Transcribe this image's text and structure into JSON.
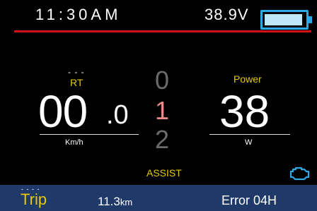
{
  "status": {
    "time": "11:30AM",
    "voltage": "38.9V",
    "battery_level_percent": 95
  },
  "speed": {
    "mode_dashes": "- - -",
    "label": "RT",
    "value_int": "00",
    "value_dec": ".0",
    "unit": "Km/h"
  },
  "assist": {
    "levels": [
      "0",
      "1",
      "2"
    ],
    "active_level": "1",
    "label": "ASSIST"
  },
  "power": {
    "label": "Power",
    "value": "38",
    "unit": "W"
  },
  "bottom": {
    "mode_dashes": "- - - -",
    "trip_label": "Trip",
    "distance_value": "11.3",
    "distance_unit": "km",
    "error_text": "Error 04H"
  },
  "icons": {
    "battery": "battery-icon",
    "engine": "engine-warning-icon"
  },
  "colors": {
    "background": "#000000",
    "accent_yellow": "#e6c800",
    "battery_blue": "#2fa8e8",
    "divider_red": "#d01212",
    "bottom_bar": "#1f3a68",
    "active_gear": "#f08a8a",
    "inactive_gear": "#6b6b6b"
  }
}
